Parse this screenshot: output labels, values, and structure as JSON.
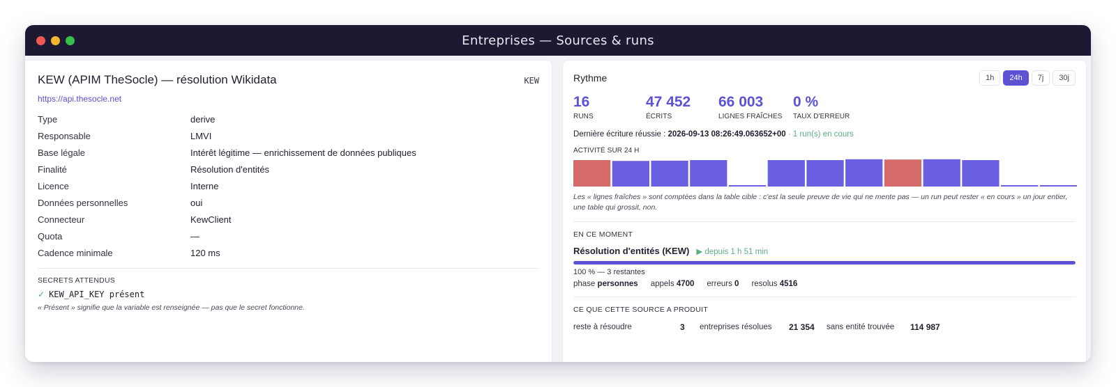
{
  "window": {
    "title": "Entreprises — Sources & runs",
    "dots": [
      {
        "name": "close",
        "color": "#ee5a52"
      },
      {
        "name": "minimize",
        "color": "#f5b62f"
      },
      {
        "name": "maximize",
        "color": "#36c24a"
      }
    ]
  },
  "source": {
    "title": "KEW (APIM TheSocle) — résolution Wikidata",
    "code": "KEW",
    "url": "https://api.thesocle.net",
    "properties": [
      {
        "label": "Type",
        "value": "derive"
      },
      {
        "label": "Responsable",
        "value": "LMVI"
      },
      {
        "label": "Base légale",
        "value": "Intérêt légitime — enrichissement de données publiques"
      },
      {
        "label": "Finalité",
        "value": "Résolution d'entités"
      },
      {
        "label": "Licence",
        "value": "Interne"
      },
      {
        "label": "Données personnelles",
        "value": "oui"
      },
      {
        "label": "Connecteur",
        "value": "KewClient"
      },
      {
        "label": "Quota",
        "value": "—"
      },
      {
        "label": "Cadence minimale",
        "value": "120 ms"
      }
    ],
    "secrets_heading": "SECRETS ATTENDUS",
    "secret": {
      "check": "✓",
      "text": "KEW_API_KEY présent"
    },
    "secrets_note": "« Présent » signifie que la variable est renseignée — pas que le secret fonctionne."
  },
  "rhythm": {
    "title": "Rythme",
    "ranges": [
      {
        "label": "1h",
        "active": false
      },
      {
        "label": "24h",
        "active": true
      },
      {
        "label": "7j",
        "active": false
      },
      {
        "label": "30j",
        "active": false
      }
    ],
    "stats": [
      {
        "value": "16",
        "label": "RUNS"
      },
      {
        "value": "47 452",
        "label": "ÉCRITS"
      },
      {
        "value": "66 003",
        "label": "LIGNES FRAÎCHES"
      },
      {
        "value": "0 %",
        "label": "TAUX D'ERREUR"
      }
    ],
    "last_write_prefix": "Dernière écriture réussie :",
    "last_write_value": "2026-09-13 08:26:49.063652+00",
    "last_write_suffix": "· 1 run(s) en cours",
    "activity_label": "ACTIVITÉ SUR 24 H",
    "activity": [
      {
        "level": 0.95,
        "status": "error"
      },
      {
        "level": 0.92,
        "status": "ok"
      },
      {
        "level": 0.93,
        "status": "ok"
      },
      {
        "level": 0.95,
        "status": "ok"
      },
      {
        "level": 0.04,
        "status": "ok"
      },
      {
        "level": 0.95,
        "status": "ok"
      },
      {
        "level": 0.95,
        "status": "ok"
      },
      {
        "level": 0.98,
        "status": "ok"
      },
      {
        "level": 0.97,
        "status": "error"
      },
      {
        "level": 0.98,
        "status": "ok"
      },
      {
        "level": 0.95,
        "status": "ok"
      },
      {
        "level": 0.04,
        "status": "ok"
      },
      {
        "level": 0.04,
        "status": "ok"
      }
    ],
    "colors": {
      "ok": "#6a5fe0",
      "error": "#d46a6a",
      "accent": "#5b52d6",
      "green": "#5cae80"
    },
    "activity_note": "Les « lignes fraîches » sont comptées dans la table cible : c'est la seule preuve de vie qui ne mente pas — un run peut rester « en cours » un jour entier, une table qui grossit, non."
  },
  "now": {
    "heading": "EN CE MOMENT",
    "run_name": "Résolution d'entités (KEW)",
    "since": "▶ depuis 1 h 51 min",
    "progress": 1.0,
    "progress_text": "100 % — 3 restantes",
    "phase_label": "phase",
    "phase_value": "personnes",
    "calls_label": "appels",
    "calls_value": "4700",
    "errors_label": "erreurs",
    "errors_value": "0",
    "resolved_label": "resolus",
    "resolved_value": "4516"
  },
  "produced": {
    "heading": "CE QUE CETTE SOURCE A PRODUIT",
    "items": [
      {
        "label": "reste à résoudre",
        "value": "3"
      },
      {
        "label": "entreprises résolues",
        "value": "21 354"
      },
      {
        "label": "sans entité trouvée",
        "value": "114 987"
      }
    ]
  }
}
